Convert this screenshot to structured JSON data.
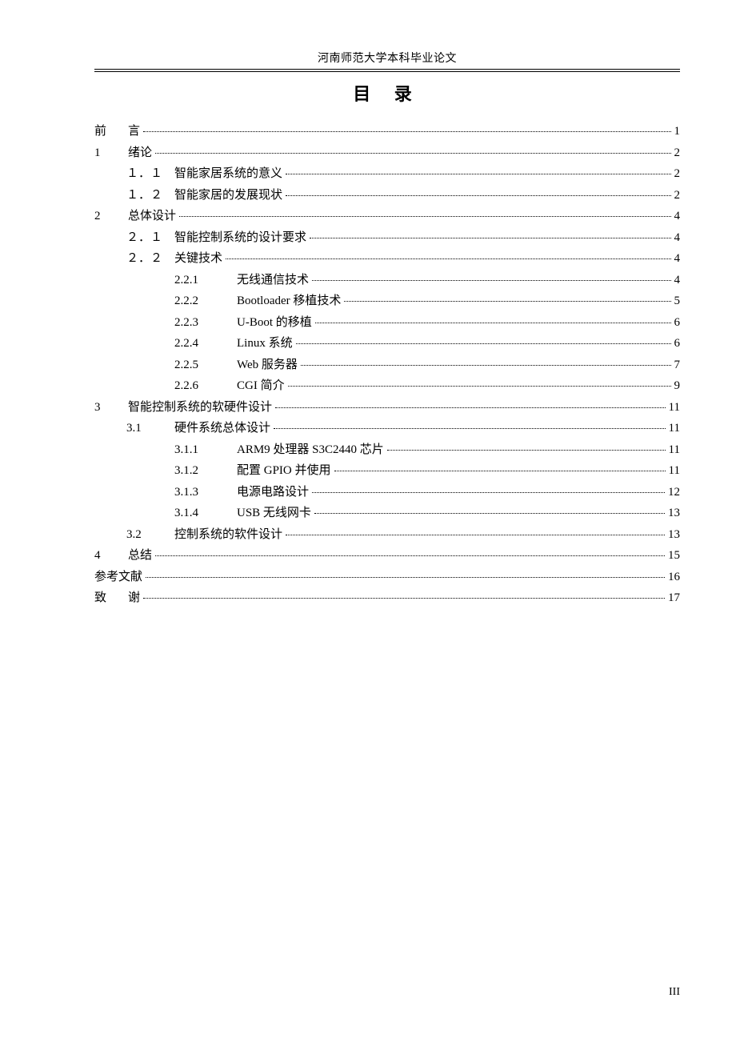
{
  "header": "河南师范大学本科毕业论文",
  "title": "目  录",
  "footer": "III",
  "toc": [
    {
      "level": 0,
      "num": "前",
      "text": "言",
      "page": "1",
      "spaced": true
    },
    {
      "level": 0,
      "num": "1",
      "text": "绪论",
      "page": "2"
    },
    {
      "level": 1,
      "num": "1.1",
      "text": "智能家居系统的意义",
      "page": "2",
      "fullwidth": true
    },
    {
      "level": 1,
      "num": "1.2",
      "text": "智能家居的发展现状",
      "page": "2",
      "fullwidth": true
    },
    {
      "level": 0,
      "num": "2",
      "text": "总体设计",
      "page": "4"
    },
    {
      "level": 1,
      "num": "2.1",
      "text": "智能控制系统的设计要求",
      "page": "4",
      "fullwidth": true
    },
    {
      "level": 1,
      "num": "2.2",
      "text": "关键技术",
      "page": "4",
      "fullwidth": true
    },
    {
      "level": 2,
      "num": "2.2.1",
      "text": "无线通信技术",
      "page": "4"
    },
    {
      "level": 2,
      "num": "2.2.2",
      "text": "Bootloader 移植技术",
      "page": "5"
    },
    {
      "level": 2,
      "num": "2.2.3",
      "text": "U-Boot 的移植",
      "page": "6"
    },
    {
      "level": 2,
      "num": "2.2.4",
      "text": "Linux 系统",
      "page": "6"
    },
    {
      "level": 2,
      "num": "2.2.5",
      "text": "Web 服务器",
      "page": "7"
    },
    {
      "level": 2,
      "num": "2.2.6",
      "text": "CGI 简介",
      "page": "9"
    },
    {
      "level": 0,
      "num": "3",
      "text": "智能控制系统的软硬件设计",
      "page": "11"
    },
    {
      "level": 1,
      "num": "3.1",
      "text": "硬件系统总体设计",
      "page": "11"
    },
    {
      "level": 2,
      "num": "3.1.1",
      "text": "ARM9 处理器 S3C2440 芯片",
      "page": "11"
    },
    {
      "level": 2,
      "num": "3.1.2",
      "text": "配置 GPIO 并使用",
      "page": "11"
    },
    {
      "level": 2,
      "num": "3.1.3",
      "text": "电源电路设计",
      "page": "12"
    },
    {
      "level": 2,
      "num": "3.1.4",
      "text": "USB 无线网卡",
      "page": "13"
    },
    {
      "level": 1,
      "num": "3.2",
      "text": "控制系统的软件设计",
      "page": "13"
    },
    {
      "level": 0,
      "num": "4",
      "text": "总结",
      "page": "15"
    },
    {
      "level": 0,
      "num": "参考文献",
      "text": "",
      "page": "16"
    },
    {
      "level": 0,
      "num": "致",
      "text": "谢",
      "page": "17",
      "spaced": true
    }
  ]
}
